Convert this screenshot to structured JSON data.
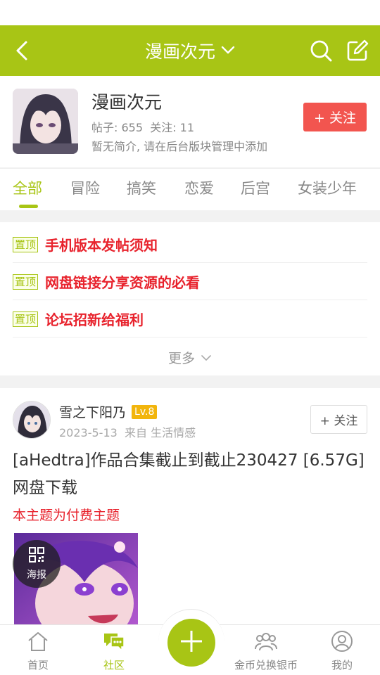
{
  "header": {
    "title": "漫画次元",
    "progress_fraction": 0.43,
    "accent_color": "#a8c515"
  },
  "forum": {
    "name": "漫画次元",
    "posts_label": "帖子: 655",
    "follow_count_label": "关注: 11",
    "description": "暂无简介, 请在后台版块管理中添加",
    "follow_button": "+ 关注"
  },
  "tabs": [
    {
      "label": "全部",
      "active": true
    },
    {
      "label": "冒险",
      "active": false
    },
    {
      "label": "搞笑",
      "active": false
    },
    {
      "label": "恋爱",
      "active": false
    },
    {
      "label": "后宫",
      "active": false
    },
    {
      "label": "女装少年",
      "active": false
    }
  ],
  "pinned": {
    "tag": "置顶",
    "items": [
      {
        "title": "手机版本发帖须知"
      },
      {
        "title": "网盘链接分享资源的必看"
      },
      {
        "title": "论坛招新给福利"
      }
    ],
    "more_label": "更多"
  },
  "post": {
    "username": "雪之下阳乃",
    "level": "Lv.8",
    "date": "2023-5-13",
    "from_label": "来自",
    "category": "生活情感",
    "follow_button": "+ 关注",
    "title": "[aHedtra]作品合集截止到截止230427 [6.57G]网盘下载",
    "paid_notice": "本主题为付费主题",
    "poster_label": "海报"
  },
  "bottom_nav": {
    "items": [
      {
        "label": "首页",
        "icon": "home-icon",
        "active": false
      },
      {
        "label": "社区",
        "icon": "community-icon",
        "active": true
      },
      {
        "label": "金币兑换银币",
        "icon": "exchange-icon",
        "active": false
      },
      {
        "label": "我的",
        "icon": "profile-icon",
        "active": false
      }
    ],
    "publish_icon": "plus-icon"
  }
}
